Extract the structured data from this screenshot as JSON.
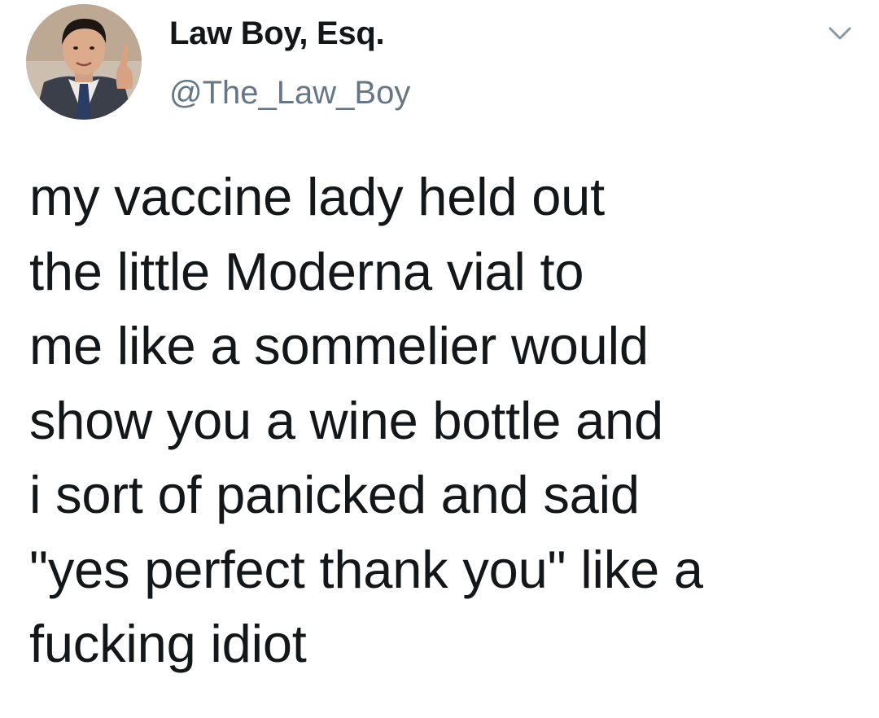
{
  "author": {
    "display_name": "Law Boy, Esq.",
    "handle": "@The_Law_Boy",
    "avatar_icon": "profile-photo"
  },
  "menu": {
    "icon": "chevron-down-icon"
  },
  "tweet": {
    "text": "my vaccine lady held out\nthe little Moderna vial to\nme like a sommelier would\nshow you a wine bottle and\ni sort of panicked and said\n\"yes perfect thank you\" like a\nfucking idiot"
  },
  "colors": {
    "text": "#14171a",
    "secondary": "#657786",
    "caret": "#8899a6",
    "background": "#ffffff"
  }
}
